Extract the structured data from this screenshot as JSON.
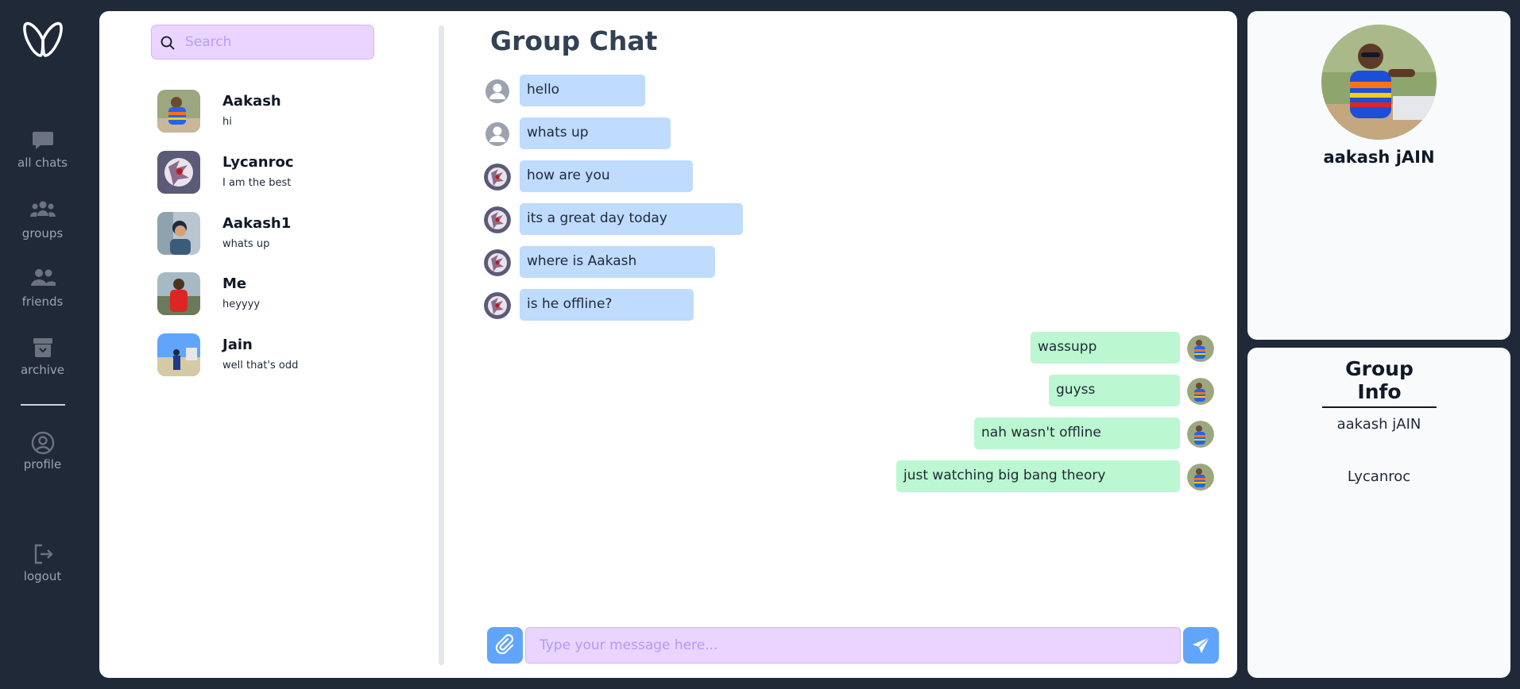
{
  "nav": {
    "items": [
      {
        "label": "all chats",
        "icon": "chat-bubble-icon"
      },
      {
        "label": "groups",
        "icon": "groups-icon"
      },
      {
        "label": "friends",
        "icon": "friends-icon"
      },
      {
        "label": "archive",
        "icon": "archive-icon"
      },
      {
        "label": "profile",
        "icon": "user-circle-icon"
      },
      {
        "label": "logout",
        "icon": "logout-icon"
      }
    ]
  },
  "search": {
    "placeholder": "Search"
  },
  "contacts": [
    {
      "name": "Aakash",
      "last_message": "hi"
    },
    {
      "name": "Lycanroc",
      "last_message": "I am the best"
    },
    {
      "name": "Aakash1",
      "last_message": "whats up"
    },
    {
      "name": "Me",
      "last_message": "heyyyy"
    },
    {
      "name": "Jain",
      "last_message": "well that's odd"
    }
  ],
  "chat": {
    "title": "Group Chat",
    "messages": [
      {
        "text": "hello",
        "direction": "in",
        "avatar": "default-user-icon"
      },
      {
        "text": "whats up",
        "direction": "in",
        "avatar": "default-user-icon"
      },
      {
        "text": "how are you",
        "direction": "in",
        "avatar": "lycanroc-avatar"
      },
      {
        "text": "its a great day today",
        "direction": "in",
        "avatar": "lycanroc-avatar"
      },
      {
        "text": "where is Aakash",
        "direction": "in",
        "avatar": "lycanroc-avatar"
      },
      {
        "text": "is he offline?",
        "direction": "in",
        "avatar": "lycanroc-avatar"
      },
      {
        "text": "wassupp",
        "direction": "out",
        "avatar": "aakash-avatar"
      },
      {
        "text": "guyss",
        "direction": "out",
        "avatar": "aakash-avatar"
      },
      {
        "text": "nah wasn't offline",
        "direction": "out",
        "avatar": "aakash-avatar"
      },
      {
        "text": "just watching big bang theory",
        "direction": "out",
        "avatar": "aakash-avatar"
      }
    ],
    "input_placeholder": "Type your message here...",
    "input_value": ""
  },
  "profile": {
    "name": "aakash jAIN"
  },
  "group_info": {
    "title": "Group Info",
    "members": [
      "aakash jAIN",
      "Lycanroc"
    ]
  },
  "colors": {
    "background": "#1f2937",
    "incoming_bubble": "#bfdbfe",
    "outgoing_bubble": "#bbf7d0",
    "input_bg": "#e9d5ff",
    "accent": "#60a5fa"
  }
}
